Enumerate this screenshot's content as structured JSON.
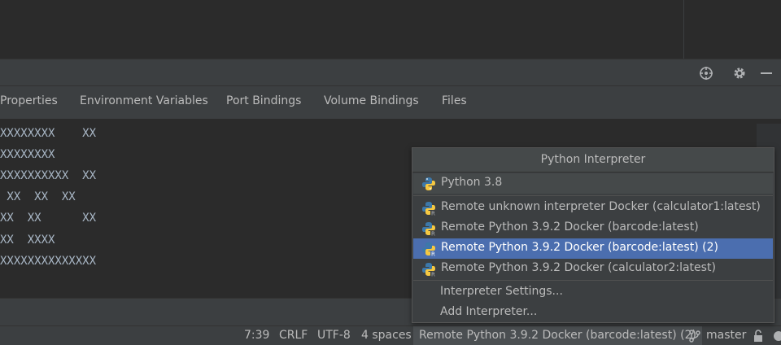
{
  "tool_window": {
    "icons": [
      "crosshair-icon",
      "gear-icon",
      "minimize-icon"
    ]
  },
  "tabs": [
    "Properties",
    "Environment Variables",
    "Port Bindings",
    "Volume Bindings",
    "Files"
  ],
  "console": {
    "lines": [
      "XXXXXXXX    XX",
      "XXXXXXXX",
      "XXXXXXXXXX  XX",
      " XX  XX  XX",
      "XX  XX      XX",
      "XX  XXXX",
      "XXXXXXXXXXXXXX"
    ]
  },
  "popup": {
    "title": "Python Interpreter",
    "current": "Python 3.8",
    "remote_items": [
      "Remote  unknown interpreter Docker (calculator1:latest)",
      "Remote Python 3.9.2 Docker (barcode:latest)",
      "Remote Python 3.9.2 Docker (barcode:latest) (2)",
      "Remote Python 3.9.2 Docker (calculator2:latest)"
    ],
    "selected_index": 2,
    "actions": [
      "Interpreter Settings...",
      "Add Interpreter..."
    ]
  },
  "status_bar": {
    "position": "7:39",
    "line_separator": "CRLF",
    "encoding": "UTF-8",
    "indent": "4 spaces",
    "interpreter": "Remote Python 3.9.2 Docker (barcode:latest) (2)",
    "branch": "master"
  },
  "colors": {
    "selection": "#4b6eaf",
    "background": "#2b2b2b",
    "panel": "#3c3f41"
  }
}
